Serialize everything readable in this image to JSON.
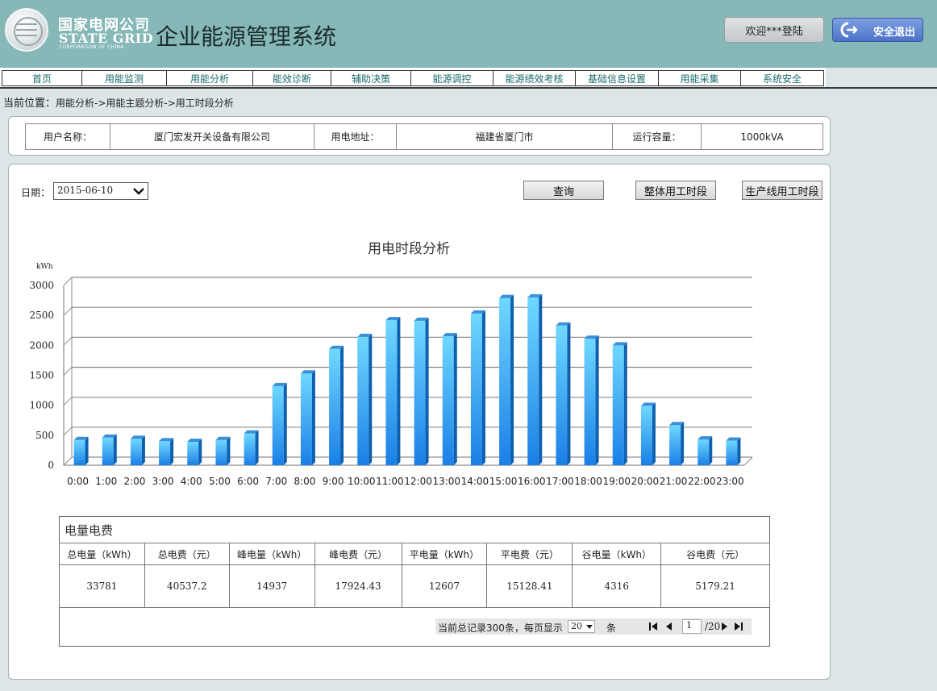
{
  "header": {
    "brand_cn": "国家电网公司",
    "brand_en": "STATE GRID",
    "brand_sub": "CORPORATION OF CHINA",
    "app_title": "企业能源管理系统",
    "welcome": "欢迎***登陆",
    "logout": "安全退出"
  },
  "nav": [
    {
      "label": "首页"
    },
    {
      "label": "用能监测"
    },
    {
      "label": "用能分析"
    },
    {
      "label": "能效诊断"
    },
    {
      "label": "辅助决策"
    },
    {
      "label": "能源调控"
    },
    {
      "label": "能源绩效考核"
    },
    {
      "label": "基础信息设置"
    },
    {
      "label": "用能采集"
    },
    {
      "label": "系统安全"
    }
  ],
  "breadcrumb": {
    "label": "当前位置：",
    "path": "用能分析->用能主题分析->用工时段分析"
  },
  "info": {
    "user_name_label": "用户名称：",
    "user_name": "厦门宏发开关设备有限公司",
    "address_label": "用电地址：",
    "address": "福建省厦门市",
    "capacity_label": "运行容量：",
    "capacity": "1000kVA"
  },
  "filters": {
    "date_label": "日期：",
    "date_value": "2015-06-10",
    "query": "查询",
    "overall": "整体用工时段",
    "line": "生产线用工时段"
  },
  "chart_data": {
    "type": "bar",
    "title": "用电时段分析",
    "ylabel": "kWh",
    "xlabel": "",
    "ylim": [
      0,
      3000
    ],
    "yticks": [
      0,
      500,
      1000,
      1500,
      2000,
      2500,
      3000
    ],
    "grid": true,
    "color_top": "#6fd8ff",
    "color_bottom": "#1a7fe6",
    "categories": [
      "0:00",
      "1:00",
      "2:00",
      "3:00",
      "4:00",
      "5:00",
      "6:00",
      "7:00",
      "8:00",
      "9:00",
      "10:00",
      "11:00",
      "12:00",
      "13:00",
      "14:00",
      "15:00",
      "16:00",
      "17:00",
      "18:00",
      "19:00",
      "20:00",
      "21:00",
      "22:00",
      "23:00"
    ],
    "values": [
      420,
      460,
      440,
      400,
      390,
      420,
      530,
      1320,
      1530,
      1940,
      2140,
      2420,
      2410,
      2150,
      2530,
      2790,
      2800,
      2330,
      2110,
      2000,
      990,
      670,
      430,
      410
    ]
  },
  "summary": {
    "title": "电量电费",
    "headers": [
      "总电量（kWh）",
      "总电费（元）",
      "峰电量（kWh）",
      "峰电费（元）",
      "平电量（kWh）",
      "平电费（元）",
      "谷电量（kWh）",
      "谷电费（元）"
    ],
    "values": [
      "33781",
      "40537.2",
      "14937",
      "17924.43",
      "12607",
      "15128.41",
      "4316",
      "5179.21"
    ]
  },
  "pager": {
    "text": "当前总记录300条，每页显示",
    "page_size": "20",
    "unit": "条",
    "page": "1",
    "total": "/20"
  }
}
